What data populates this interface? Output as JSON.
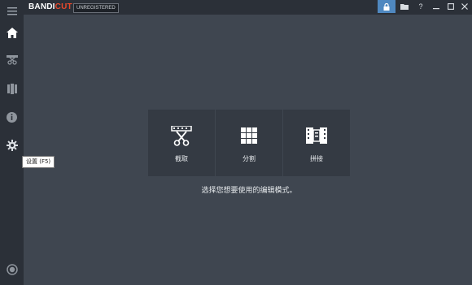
{
  "app": {
    "brand_prefix": "BANDI",
    "brand_suffix": "CUT",
    "badge": "UNREGISTERED"
  },
  "colors": {
    "background": "#3f4650",
    "sidebar": "#2b3038",
    "card": "#343a43",
    "accent_blue": "#4f88c0",
    "brand_orange": "#e8492b"
  },
  "titlebar": {
    "help_label": "?",
    "icons": [
      "lock-icon",
      "folder-icon",
      "help-icon",
      "minimize-icon",
      "maximize-icon",
      "close-icon"
    ]
  },
  "sidebar": {
    "items": [
      {
        "icon": "menu-icon"
      },
      {
        "icon": "home-icon"
      },
      {
        "icon": "cut-tool-icon"
      },
      {
        "icon": "join-tool-icon"
      },
      {
        "icon": "info-icon"
      },
      {
        "icon": "gear-icon"
      },
      {
        "icon": "record-icon"
      }
    ],
    "tooltip": "设置 (F5)"
  },
  "modes": [
    {
      "label": "截取",
      "icon": "trim-scissors-icon"
    },
    {
      "label": "分割",
      "icon": "split-grid-icon"
    },
    {
      "label": "拼接",
      "icon": "join-film-icon"
    }
  ],
  "prompt": "选择您想要使用的编辑模式。"
}
